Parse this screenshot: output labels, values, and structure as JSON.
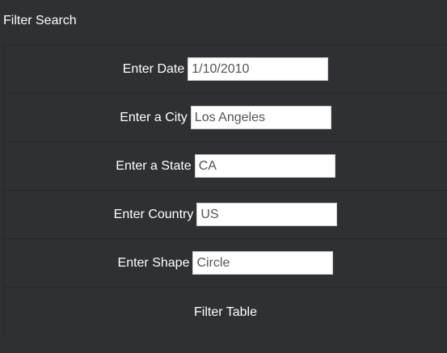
{
  "panel": {
    "heading": "Filter Search"
  },
  "filters": [
    {
      "label": "Enter Date",
      "value": "1/10/2010"
    },
    {
      "label": "Enter a City",
      "value": "Los Angeles"
    },
    {
      "label": "Enter a State",
      "value": "CA"
    },
    {
      "label": "Enter Country",
      "value": "US"
    },
    {
      "label": "Enter Shape",
      "value": "Circle"
    }
  ],
  "filter_button_label": "Filter Table",
  "colors": {
    "background": "#2f3033",
    "border": "#26272a",
    "text": "#ffffff",
    "input_background": "#ffffff",
    "input_text": "#555555"
  }
}
